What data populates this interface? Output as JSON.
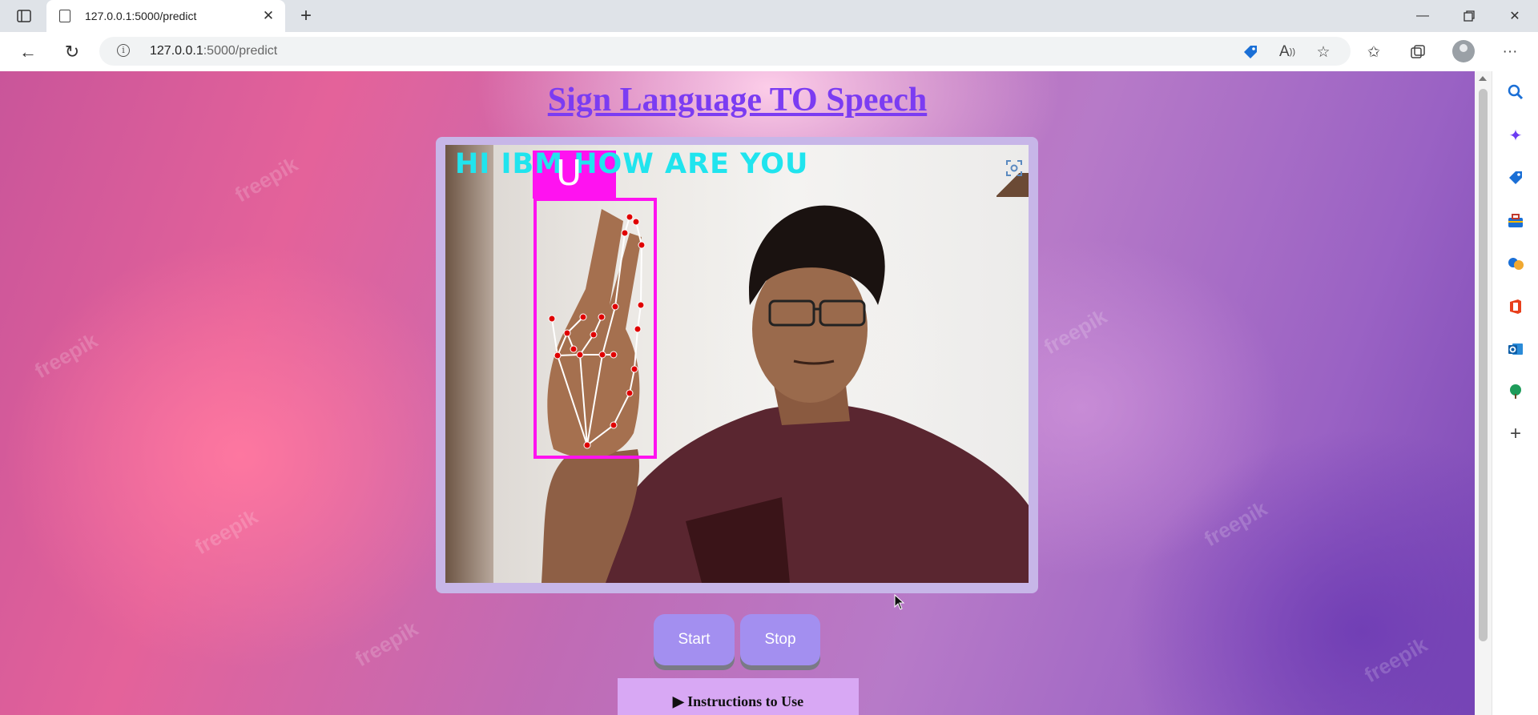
{
  "browser": {
    "tab_title": "127.0.0.1:5000/predict",
    "url_host": "127.0.0.1",
    "url_rest": ":5000/predict",
    "icons": [
      "tab-actions-icon",
      "page-icon",
      "close-icon",
      "new-tab-icon",
      "minimize-icon",
      "restore-icon",
      "window-close-icon",
      "back-icon",
      "reload-icon",
      "info-icon",
      "shopping-tag-icon",
      "read-aloud-icon",
      "add-favorite-icon",
      "favorites-icon",
      "collections-icon",
      "profile-avatar",
      "more-options-icon"
    ]
  },
  "page": {
    "title": "Sign Language TO Speech",
    "video": {
      "caption": "HI IBM HOW ARE YOU",
      "detected_letter": "U"
    },
    "buttons": {
      "start": "Start",
      "stop": "Stop"
    },
    "instructions_label": "▶ Instructions to Use",
    "watermark": "freepik"
  },
  "sidebar": {
    "icons": [
      "search-icon",
      "copilot-icon",
      "shopping-icon",
      "tools-icon",
      "games-icon",
      "office-icon",
      "outlook-icon",
      "tree-icon",
      "add-icon"
    ]
  },
  "colors": {
    "title": "#7b3cf2",
    "button": "#a38ff0",
    "caption": "#20e4ee",
    "hand_box": "#ff12f0",
    "instructions_bg": "#d8a8f4"
  }
}
